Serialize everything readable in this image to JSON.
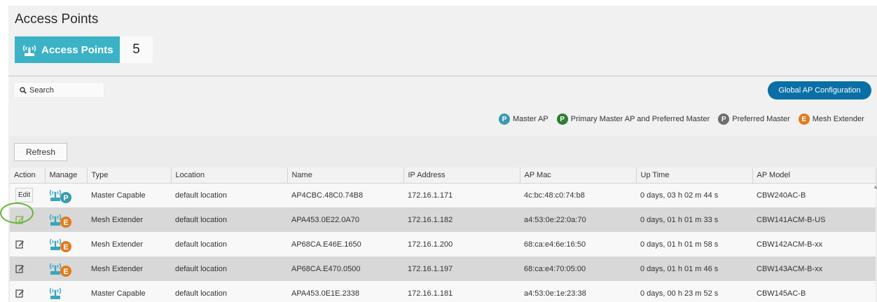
{
  "page": {
    "title": "Access Points"
  },
  "summary": {
    "label": "Access Points",
    "count": "5"
  },
  "search": {
    "label": "Search"
  },
  "global_button": {
    "label": "Global AP Configuration"
  },
  "legend": [
    {
      "letter": "P",
      "label": "Master AP",
      "color": "#3a9ab0"
    },
    {
      "letter": "P",
      "label": "Primary Master AP and Preferred Master",
      "color": "#2e7d32"
    },
    {
      "letter": "P",
      "label": "Preferred Master",
      "color": "#6d6d6d"
    },
    {
      "letter": "E",
      "label": "Mesh Extender",
      "color": "#e07b1c"
    }
  ],
  "refresh": {
    "label": "Refresh"
  },
  "table": {
    "columns": [
      "Action",
      "Manage",
      "Type",
      "Location",
      "Name",
      "IP Address",
      "AP Mac",
      "Up Time",
      "AP Model"
    ],
    "rows": [
      {
        "action": "Edit",
        "badge": "P",
        "type": "Master Capable",
        "location": "default location",
        "name": "AP4CBC.48C0.74B8",
        "ip": "172.16.1.171",
        "mac": "4c:bc:48:c0:74:b8",
        "uptime": "0 days, 03 h 02 m 44 s",
        "model": "CBW240AC-B"
      },
      {
        "action": "edit-icon",
        "badge": "E",
        "type": "Mesh Extender",
        "location": "default location",
        "name": "APA453.0E22.0A70",
        "ip": "172.16.1.182",
        "mac": "a4:53:0e:22:0a:70",
        "uptime": "0 days, 01 h 01 m 33 s",
        "model": "CBW141ACM-B-US"
      },
      {
        "action": "edit-icon",
        "badge": "E",
        "type": "Mesh Extender",
        "location": "default location",
        "name": "AP68CA.E46E.1650",
        "ip": "172.16.1.200",
        "mac": "68:ca:e4:6e:16:50",
        "uptime": "0 days, 01 h 01 m 58 s",
        "model": "CBW142ACM-B-xx"
      },
      {
        "action": "edit-icon",
        "badge": "E",
        "type": "Mesh Extender",
        "location": "default location",
        "name": "AP68CA.E470.0500",
        "ip": "172.16.1.197",
        "mac": "68:ca:e4:70:05:00",
        "uptime": "0 days, 01 h 01 m 46 s",
        "model": "CBW143ACM-B-xx"
      },
      {
        "action": "edit-icon",
        "badge": "",
        "type": "Master Capable",
        "location": "default location",
        "name": "APA453.0E1E.2338",
        "ip": "172.16.1.181",
        "mac": "a4:53:0e:1e:23:38",
        "uptime": "0 days, 00 h 23 m 52 s",
        "model": "CBW145AC-B"
      }
    ]
  },
  "colors": {
    "accent": "#3cb2c6",
    "button": "#0a6fa6",
    "highlight_ring": "#68b53c",
    "badge_p": "#3a9ab0",
    "badge_e": "#e07b1c"
  }
}
